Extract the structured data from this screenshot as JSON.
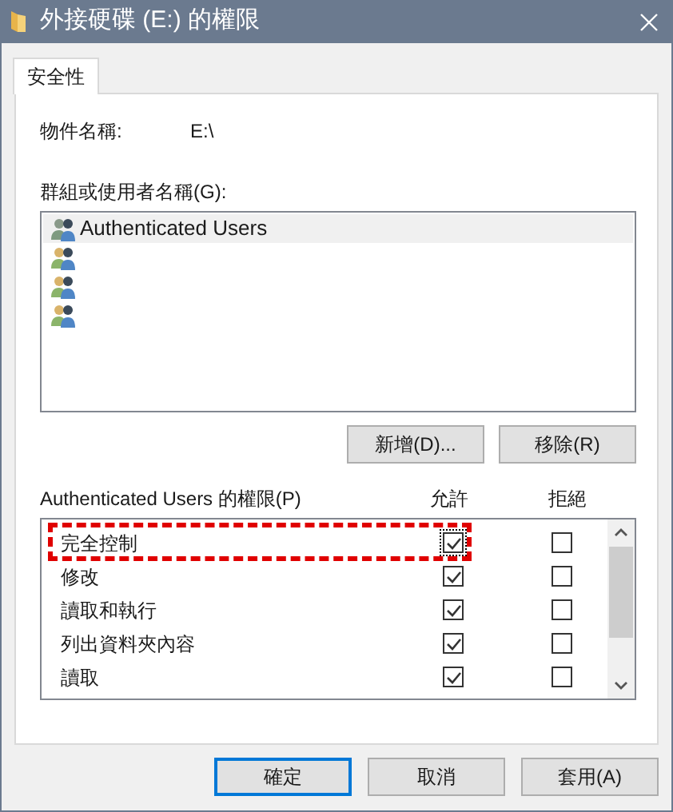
{
  "window": {
    "title": "外接硬碟 (E:) 的權限"
  },
  "tabs": [
    {
      "label": "安全性",
      "selected": true
    }
  ],
  "object_name": {
    "label": "物件名稱:",
    "value": "E:\\"
  },
  "groups": {
    "label": "群組或使用者名稱(G):",
    "items": [
      {
        "label": "Authenticated Users",
        "selected": true
      },
      {
        "selected": false
      },
      {
        "selected": false
      },
      {
        "selected": false
      }
    ],
    "buttons": [
      "新增(D)...",
      "移除(R)"
    ]
  },
  "permissions": {
    "label": "Authenticated Users 的權限(P)",
    "allow_header": "允許",
    "deny_header": "拒絕",
    "rows": [
      {
        "label": "完全控制",
        "allow": true,
        "deny": false,
        "highlighted": true,
        "focused": true
      },
      {
        "label": "修改",
        "allow": true,
        "deny": false,
        "highlighted": false,
        "focused": false
      },
      {
        "label": "讀取和執行",
        "allow": true,
        "deny": false,
        "highlighted": false,
        "focused": false
      },
      {
        "label": "列出資料夾內容",
        "allow": true,
        "deny": false,
        "highlighted": false,
        "focused": false
      },
      {
        "label": "讀取",
        "allow": true,
        "deny": false,
        "highlighted": false,
        "focused": false
      }
    ]
  },
  "buttons": [
    {
      "label": "確定",
      "default": true
    },
    {
      "label": "取消",
      "default": false
    },
    {
      "label": "套用(A)",
      "default": false
    }
  ]
}
